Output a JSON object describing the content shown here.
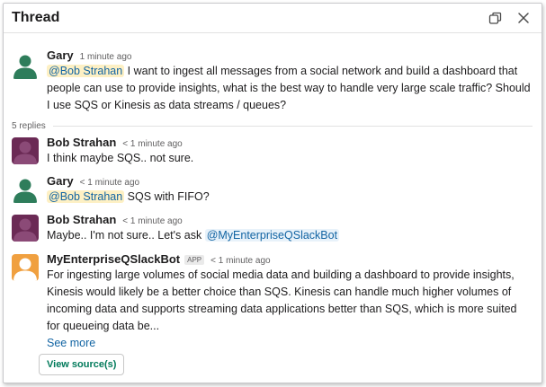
{
  "header": {
    "title": "Thread",
    "icons": [
      "open-in-window-icon",
      "close-icon"
    ]
  },
  "parent_message": {
    "author": "Gary",
    "time": "1 minute ago",
    "mention": "@Bob Strahan",
    "text": " I want to ingest all messages from a social network and build a dashboard that people can use to provide insights, what is the best way to handle very large scale traffic? Should I use SQS or Kinesis as data streams / queues?"
  },
  "replies_label": "5 replies",
  "replies": [
    {
      "author": "Bob Strahan",
      "time": "< 1 minute ago",
      "text": "I think maybe SQS.. not sure."
    },
    {
      "author": "Gary",
      "time": "< 1 minute ago",
      "mention": "@Bob Strahan",
      "text": " SQS with FIFO?"
    },
    {
      "author": "Bob Strahan",
      "time": "< 1 minute ago",
      "text": "Maybe.. I'm not sure.. Let's ask ",
      "mention": "@MyEnterpriseQSlackBot"
    },
    {
      "author": "MyEnterpriseQSlackBot",
      "badge": "APP",
      "time": "< 1 minute ago",
      "text": "For ingesting large volumes of social media data and building a dashboard to provide insights, Kinesis would likely be a better choice than SQS. Kinesis can handle much higher volumes of incoming data and supports streaming data applications better than SQS, which is more suited for queueing data be...",
      "see_more": "See more",
      "source_button": "View source(s)"
    }
  ],
  "colors": {
    "gary_avatar": "#2e7d5b",
    "bob_avatar": "#6b2a55",
    "bot_avatar": "#f0a040",
    "link": "#1264a3",
    "button_text": "#007a5a"
  }
}
